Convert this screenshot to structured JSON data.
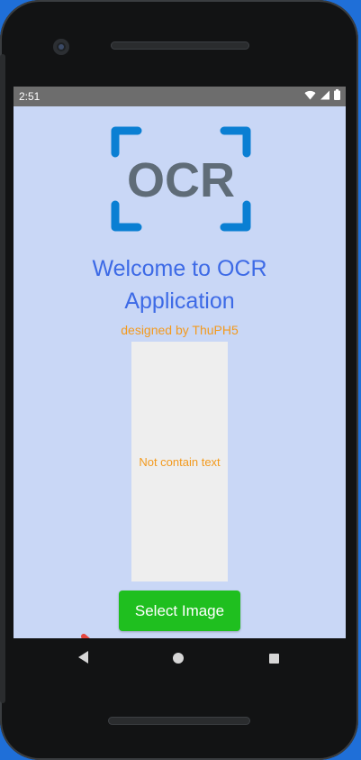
{
  "status_bar": {
    "time": "2:51"
  },
  "logo": {
    "text": "OCR",
    "icon": "ocr-scan-logo",
    "bracket_color": "#0a7fd3",
    "text_color": "#5f6c78"
  },
  "welcome": {
    "line1": "Welcome to OCR",
    "line2": "Application"
  },
  "designed_by": "designed by ThuPH5",
  "image_box": {
    "placeholder": "Not contain text"
  },
  "select_button": {
    "label": "Select Image"
  },
  "colors": {
    "screen_bg": "#c9d7f6",
    "accent_blue": "#3d6ae6",
    "accent_orange": "#f39a1e",
    "button_green": "#1fbf1f",
    "annotation_arrow": "#e5463f"
  },
  "icons": {
    "status": [
      "wifi-icon",
      "signal-icon",
      "battery-icon"
    ],
    "nav": [
      "back-icon",
      "home-icon",
      "recent-apps-icon"
    ],
    "annotation": "red-arrow-icon"
  }
}
